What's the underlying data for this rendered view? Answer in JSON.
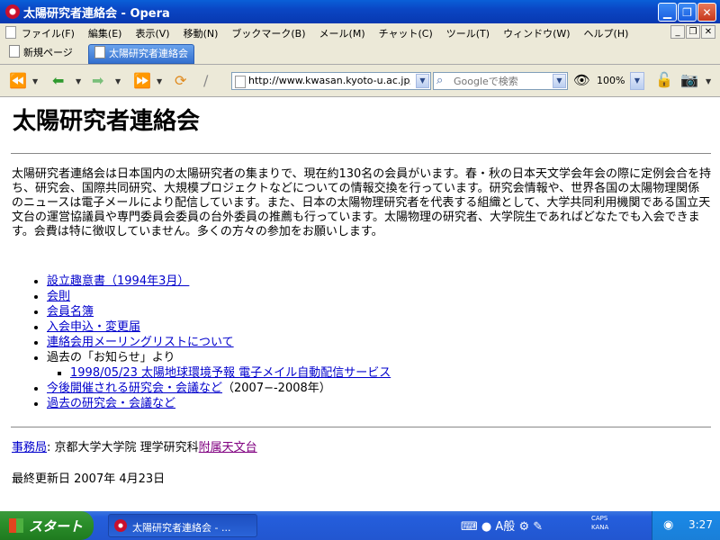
{
  "window": {
    "title": "太陽研究者連絡会 - Opera"
  },
  "menu": {
    "items": [
      "ファイル(F)",
      "編集(E)",
      "表示(V)",
      "移動(N)",
      "ブックマーク(B)",
      "メール(M)",
      "チャット(C)",
      "ツール(T)",
      "ウィンドウ(W)",
      "ヘルプ(H)"
    ]
  },
  "tabs": [
    {
      "label": "新規ページ",
      "active": false
    },
    {
      "label": "太陽研究者連絡会",
      "active": true
    }
  ],
  "toolbar": {
    "address_value": "http://www.kwasan.kyoto-u.ac.jp/r",
    "search_placeholder": "Googleで検索",
    "zoom_value": "100%"
  },
  "page": {
    "heading": "太陽研究者連絡会",
    "intro": "太陽研究者連絡会は日本国内の太陽研究者の集まりで、現在約130名の会員がいます。春・秋の日本天文学会年会の際に定例会合を持ち、研究会、国際共同研究、大規模プロジェクトなどについての情報交換を行っています。研究会情報や、世界各国の太陽物理関係のニュースは電子メールにより配信しています。また、日本の太陽物理研究者を代表する組織として、大学共同利用機関である国立天文台の運営協議員や専門委員会委員の台外委員の推薦も行っています。太陽物理の研究者、大学院生であればどなたでも入会できます。会費は特に徴収していません。多くの方々の参加をお願いします。",
    "links": [
      {
        "text": "設立趣意書（1994年3月）"
      },
      {
        "text": "会則"
      },
      {
        "text": "会員名簿"
      },
      {
        "text": "入会申込・変更届"
      },
      {
        "text": "連絡会用メーリングリストについて"
      }
    ],
    "oshirase_label": "過去の「お知らせ」より",
    "oshirase_sub": "1998/05/23 太陽地球環境予報 電子メイル自動配信サービス",
    "upcoming_link": "今後開催される研究会・会議など",
    "upcoming_suffix": "（2007−-2008年）",
    "past_link": "過去の研究会・会議など",
    "office_link": "事務局",
    "office_text": ":  京都大学大学院 理学研究科",
    "office_link2": "附属天文台",
    "updated": "最終更新日  2007年 4月23日"
  },
  "taskbar": {
    "start_label": "スタート",
    "task_label": "太陽研究者連絡会 - ...",
    "ime_text": "A般",
    "caps_label": "CAPS",
    "kana_label": "KANA",
    "clock": "3:27"
  }
}
